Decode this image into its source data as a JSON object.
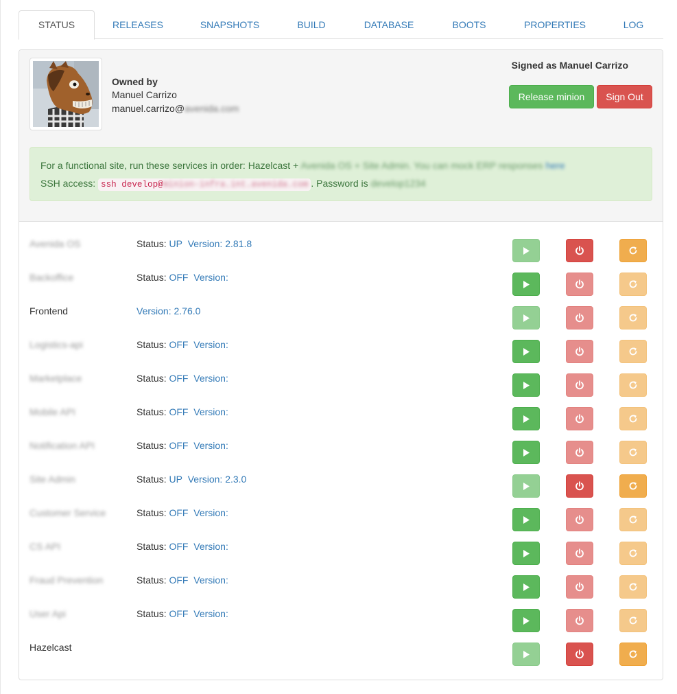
{
  "tabs": [
    "STATUS",
    "RELEASES",
    "SNAPSHOTS",
    "BUILD",
    "DATABASE",
    "BOOTS",
    "PROPERTIES",
    "LOG"
  ],
  "active_tab": "STATUS",
  "owner": {
    "label": "Owned by",
    "name": "Manuel Carrizo",
    "email_visible": "manuel.carrizo@",
    "email_blurred": "avenida.com"
  },
  "session": {
    "signed_as": "Signed as Manuel Carrizo",
    "release_label": "Release minion",
    "signout_label": "Sign Out"
  },
  "alert": {
    "line1_visible": "For a functional site, run these services in order: Hazelcast + ",
    "line1_blurred": "Avenida OS + Site Admin. You can mock ERP responses",
    "line1_link": "here",
    "line2_prefix": "SSH access: ",
    "ssh_visible": "ssh develop@",
    "ssh_blurred": "minion-infra.int.avenida.com",
    "line2_mid": ". Password is ",
    "password_blurred": "develop1234"
  },
  "labels": {
    "status": "Status:",
    "version": "Version:"
  },
  "services": [
    {
      "name": "Avenida OS",
      "blurred": true,
      "show_status": true,
      "status": "UP",
      "version": "2.81.8",
      "play_enabled": false,
      "stop_enabled": true,
      "restart_enabled": true
    },
    {
      "name": "Backoffice",
      "blurred": true,
      "show_status": true,
      "status": "OFF",
      "version": "",
      "play_enabled": true,
      "stop_enabled": false,
      "restart_enabled": false
    },
    {
      "name": "Frontend",
      "blurred": false,
      "show_status": false,
      "status": "",
      "version": "2.76.0",
      "play_enabled": false,
      "stop_enabled": false,
      "restart_enabled": false
    },
    {
      "name": "Logistics-api",
      "blurred": true,
      "show_status": true,
      "status": "OFF",
      "version": "",
      "play_enabled": true,
      "stop_enabled": false,
      "restart_enabled": false
    },
    {
      "name": "Marketplace",
      "blurred": true,
      "show_status": true,
      "status": "OFF",
      "version": "",
      "play_enabled": true,
      "stop_enabled": false,
      "restart_enabled": false
    },
    {
      "name": "Mobile API",
      "blurred": true,
      "show_status": true,
      "status": "OFF",
      "version": "",
      "play_enabled": true,
      "stop_enabled": false,
      "restart_enabled": false
    },
    {
      "name": "Notification API",
      "blurred": true,
      "show_status": true,
      "status": "OFF",
      "version": "",
      "play_enabled": true,
      "stop_enabled": false,
      "restart_enabled": false
    },
    {
      "name": "Site Admin",
      "blurred": true,
      "show_status": true,
      "status": "UP",
      "version": "2.3.0",
      "play_enabled": false,
      "stop_enabled": true,
      "restart_enabled": true
    },
    {
      "name": "Customer Service",
      "blurred": true,
      "show_status": true,
      "status": "OFF",
      "version": "",
      "play_enabled": true,
      "stop_enabled": false,
      "restart_enabled": false
    },
    {
      "name": "CS API",
      "blurred": true,
      "show_status": true,
      "status": "OFF",
      "version": "",
      "play_enabled": true,
      "stop_enabled": false,
      "restart_enabled": false
    },
    {
      "name": "Fraud Prevention",
      "blurred": true,
      "show_status": true,
      "status": "OFF",
      "version": "",
      "play_enabled": true,
      "stop_enabled": false,
      "restart_enabled": false
    },
    {
      "name": "User Api",
      "blurred": true,
      "show_status": true,
      "status": "OFF",
      "version": "",
      "play_enabled": true,
      "stop_enabled": false,
      "restart_enabled": false
    },
    {
      "name": "Hazelcast",
      "blurred": false,
      "show_status": false,
      "status": "",
      "version": null,
      "play_enabled": false,
      "stop_enabled": true,
      "restart_enabled": true
    }
  ],
  "colors": {
    "link": "#337ab7",
    "success": "#5cb85c",
    "danger": "#d9534f",
    "warning": "#f0ad4e",
    "alert_bg": "#dff0d8",
    "alert_text": "#3c763d"
  },
  "icons": {
    "play": "play-icon",
    "stop": "power-icon",
    "restart": "refresh-icon",
    "avatar": "horse-mask-avatar"
  }
}
